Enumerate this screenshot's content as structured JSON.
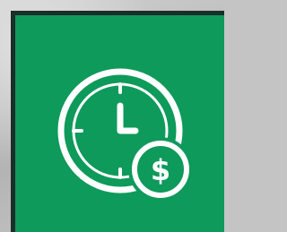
{
  "icon": {
    "name": "time-is-money-icon",
    "glyph_clock": "clock-icon",
    "glyph_coin": "dollar-coin-icon",
    "currency_symbol": "$"
  },
  "colors": {
    "tile_background": "#0e9a5a",
    "tile_shadow": "#1a2e2a",
    "icon_stroke": "#ffffff",
    "page_background": "#c4c4c4"
  }
}
